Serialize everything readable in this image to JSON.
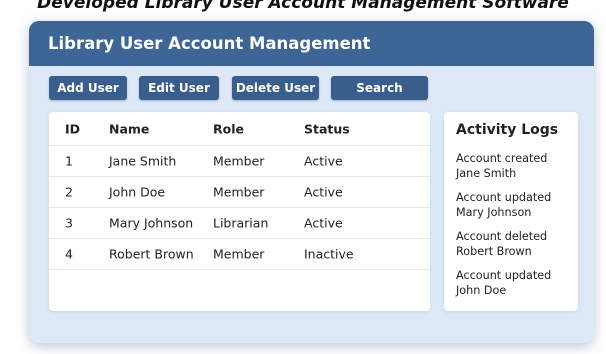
{
  "caption": "Developed Library User Account Management Software",
  "window": {
    "title": "Library User Account Management"
  },
  "toolbar": {
    "add_label": "Add User",
    "edit_label": "Edit User",
    "delete_label": "Delete User",
    "search_label": "Search"
  },
  "table": {
    "headers": {
      "id": "ID",
      "name": "Name",
      "role": "Role",
      "status": "Status"
    },
    "rows": [
      {
        "id": "1",
        "name": "Jane Smith",
        "role": "Member",
        "status": "Active"
      },
      {
        "id": "2",
        "name": "John Doe",
        "role": "Member",
        "status": "Active"
      },
      {
        "id": "3",
        "name": "Mary Johnson",
        "role": "Librarian",
        "status": "Active"
      },
      {
        "id": "4",
        "name": "Robert Brown",
        "role": "Member",
        "status": "Inactive"
      }
    ]
  },
  "activity": {
    "title": "Activity Logs",
    "entries": [
      {
        "action": "Account created",
        "user": "Jane Smith"
      },
      {
        "action": "Account updated",
        "user": "Mary Johnson"
      },
      {
        "action": "Account deleted",
        "user": "Robert Brown"
      },
      {
        "action": "Account updated",
        "user": "John Doe"
      }
    ]
  },
  "colors": {
    "header": "#3d6596",
    "button": "#395d8d",
    "background": "#dde9f6"
  }
}
